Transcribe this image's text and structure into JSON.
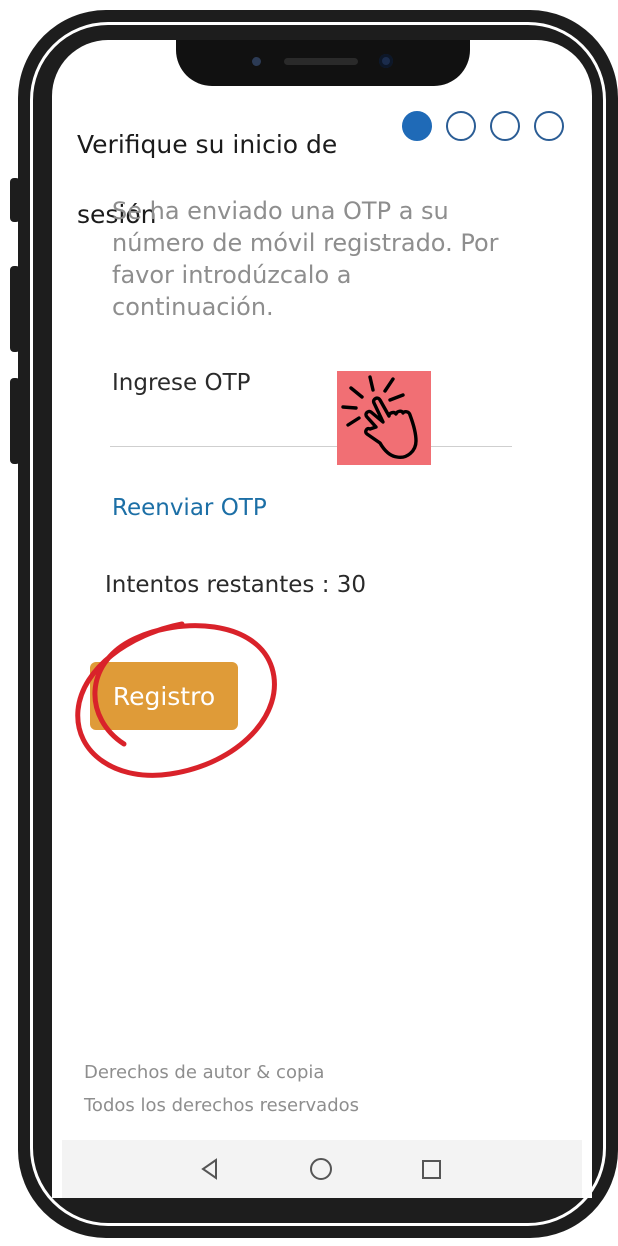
{
  "header": {
    "title": "Verifique su inicio de sesión",
    "steps": [
      {
        "active": true
      },
      {
        "active": false
      },
      {
        "active": false
      },
      {
        "active": false
      }
    ]
  },
  "content": {
    "description": "Se ha enviado una OTP a su número de móvil registrado. Por favor introdúzcalo a continuación.",
    "otp_label": "Ingrese OTP",
    "otp_value": "",
    "resend_label": "Reenviar OTP",
    "attempts_label": "Intentos restantes : 30",
    "register_label": "Registro"
  },
  "annotations": {
    "tap_icon": "hand-tap-icon",
    "highlight": "red-circle-highlight"
  },
  "footer": {
    "line1": "Derechos de autor & copia",
    "line2": "Todos los derechos reservados"
  },
  "navbar": {
    "back_icon": "back-triangle-icon",
    "home_icon": "home-circle-icon",
    "recents_icon": "recents-square-icon"
  },
  "colors": {
    "accent": "#1f6ab7",
    "button": "#df9b38",
    "link": "#1c6fa6",
    "highlight": "#d9222a",
    "tap_bg": "#f16f74"
  }
}
